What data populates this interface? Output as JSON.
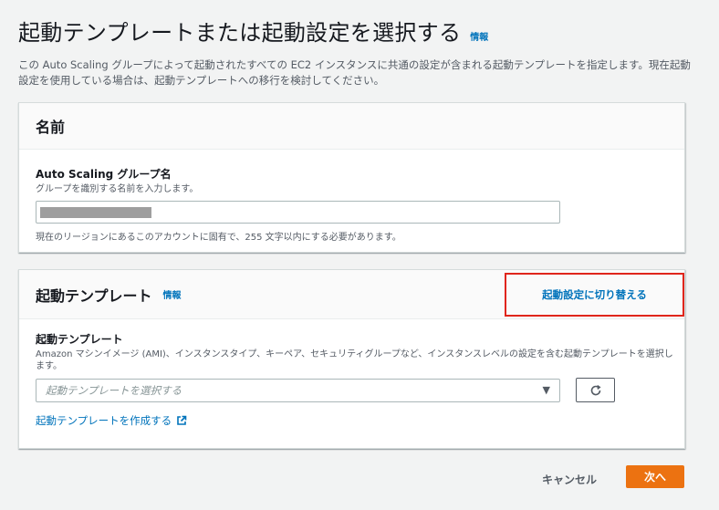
{
  "header": {
    "title": "起動テンプレートまたは起動設定を選択する",
    "info_label": "情報",
    "description": "この Auto Scaling グループによって起動されたすべての EC2 インスタンスに共通の設定が含まれる起動テンプレートを指定します。現在起動設定を使用している場合は、起動テンプレートへの移行を検討してください。"
  },
  "name_section": {
    "title": "名前",
    "field_label": "Auto Scaling グループ名",
    "field_description": "グループを識別する名前を入力します。",
    "input_value": "",
    "constraint": "現在のリージョンにあるこのアカウントに固有で、255 文字以内にする必要があります。"
  },
  "template_section": {
    "title": "起動テンプレート",
    "info_label": "情報",
    "switch_label": "起動設定に切り替える",
    "field_label": "起動テンプレート",
    "field_description": "Amazon マシンイメージ (AMI)、インスタンスタイプ、キーペア、セキュリティグループなど、インスタンスレベルの設定を含む起動テンプレートを選択します。",
    "select_placeholder": "起動テンプレートを選択する",
    "create_link": "起動テンプレートを作成する"
  },
  "footer": {
    "cancel_label": "キャンセル",
    "next_label": "次へ"
  },
  "colors": {
    "primary_button": "#ec7211",
    "link": "#0073bb",
    "highlight_border": "#e0251b"
  },
  "icons": {
    "caret": "caret-down-icon",
    "refresh": "refresh-icon",
    "external": "external-link-icon"
  }
}
